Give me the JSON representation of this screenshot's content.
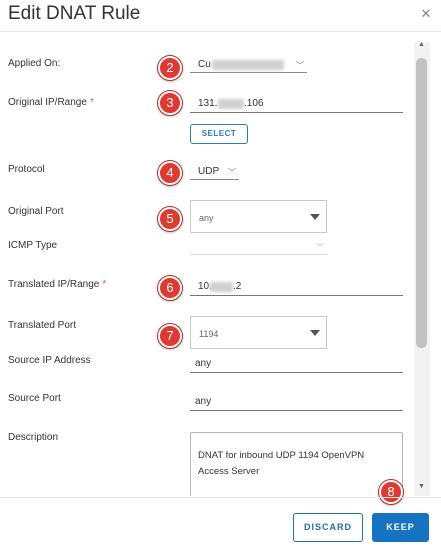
{
  "dialog": {
    "title": "Edit DNAT Rule",
    "close_glyph": "✕"
  },
  "fields": {
    "applied_on": {
      "label": "Applied On:",
      "value_prefix": "Cu"
    },
    "original_ip": {
      "label": "Original IP/Range",
      "required": "*",
      "value_prefix": "131.",
      "value_suffix": ".106"
    },
    "select_button": "SELECT",
    "protocol": {
      "label": "Protocol",
      "value": "UDP"
    },
    "original_port": {
      "label": "Original Port",
      "value": "any"
    },
    "icmp_type": {
      "label": "ICMP Type",
      "value": ""
    },
    "translated_ip": {
      "label": "Translated IP/Range",
      "required": "*",
      "value_prefix": "10.",
      "value_suffix": ".2"
    },
    "translated_port": {
      "label": "Translated Port",
      "value": "1194"
    },
    "source_ip": {
      "label": "Source IP Address",
      "value": "any"
    },
    "source_port": {
      "label": "Source Port",
      "value": "any"
    },
    "description": {
      "label": "Description",
      "value": "DNAT for inbound UDP 1194 OpenVPN Access Server"
    }
  },
  "annotations": [
    "2",
    "3",
    "4",
    "5",
    "6",
    "7",
    "8"
  ],
  "footer": {
    "discard": "DISCARD",
    "keep": "KEEP"
  },
  "colors": {
    "accent": "#1573bf",
    "badge": "#dd3a33",
    "required": "#e35555"
  }
}
